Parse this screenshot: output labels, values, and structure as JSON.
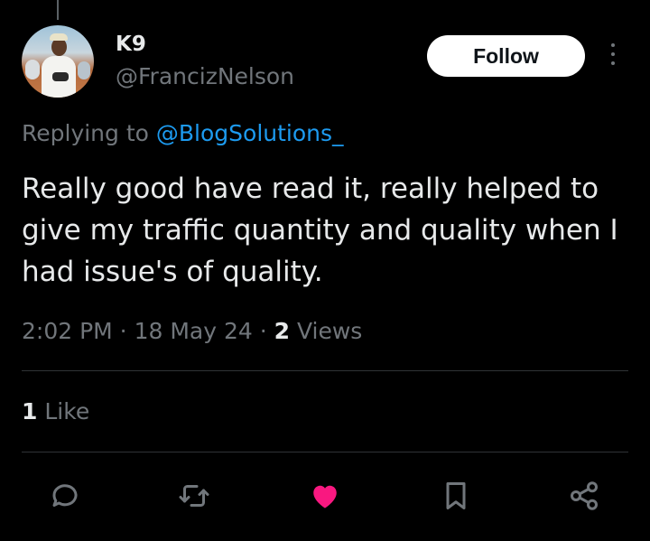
{
  "author": {
    "name": "K9",
    "handle": "@FrancizNelson",
    "follow_label": "Follow"
  },
  "reply": {
    "prefix": "Replying to ",
    "mention": "@BlogSolutions_"
  },
  "tweet": {
    "text": "Really good have read it, really helped to give my traffic quantity and quality when I had issue's of quality."
  },
  "meta": {
    "time": "2:02 PM",
    "sep1": " · ",
    "date": "18 May 24",
    "sep2": " · ",
    "views_count": "2",
    "views_label": " Views"
  },
  "engagement": {
    "likes_count": "1",
    "likes_label": " Like"
  },
  "actions": [
    {
      "icon": "reply-icon"
    },
    {
      "icon": "retweet-icon"
    },
    {
      "icon": "heart-icon",
      "active_color": "#f91880"
    },
    {
      "icon": "bookmark-icon"
    },
    {
      "icon": "share-icon"
    }
  ],
  "colors": {
    "background": "#000000",
    "text": "#e7e9ea",
    "secondary": "#71767b",
    "link": "#1d9bf0",
    "like": "#f91880"
  }
}
